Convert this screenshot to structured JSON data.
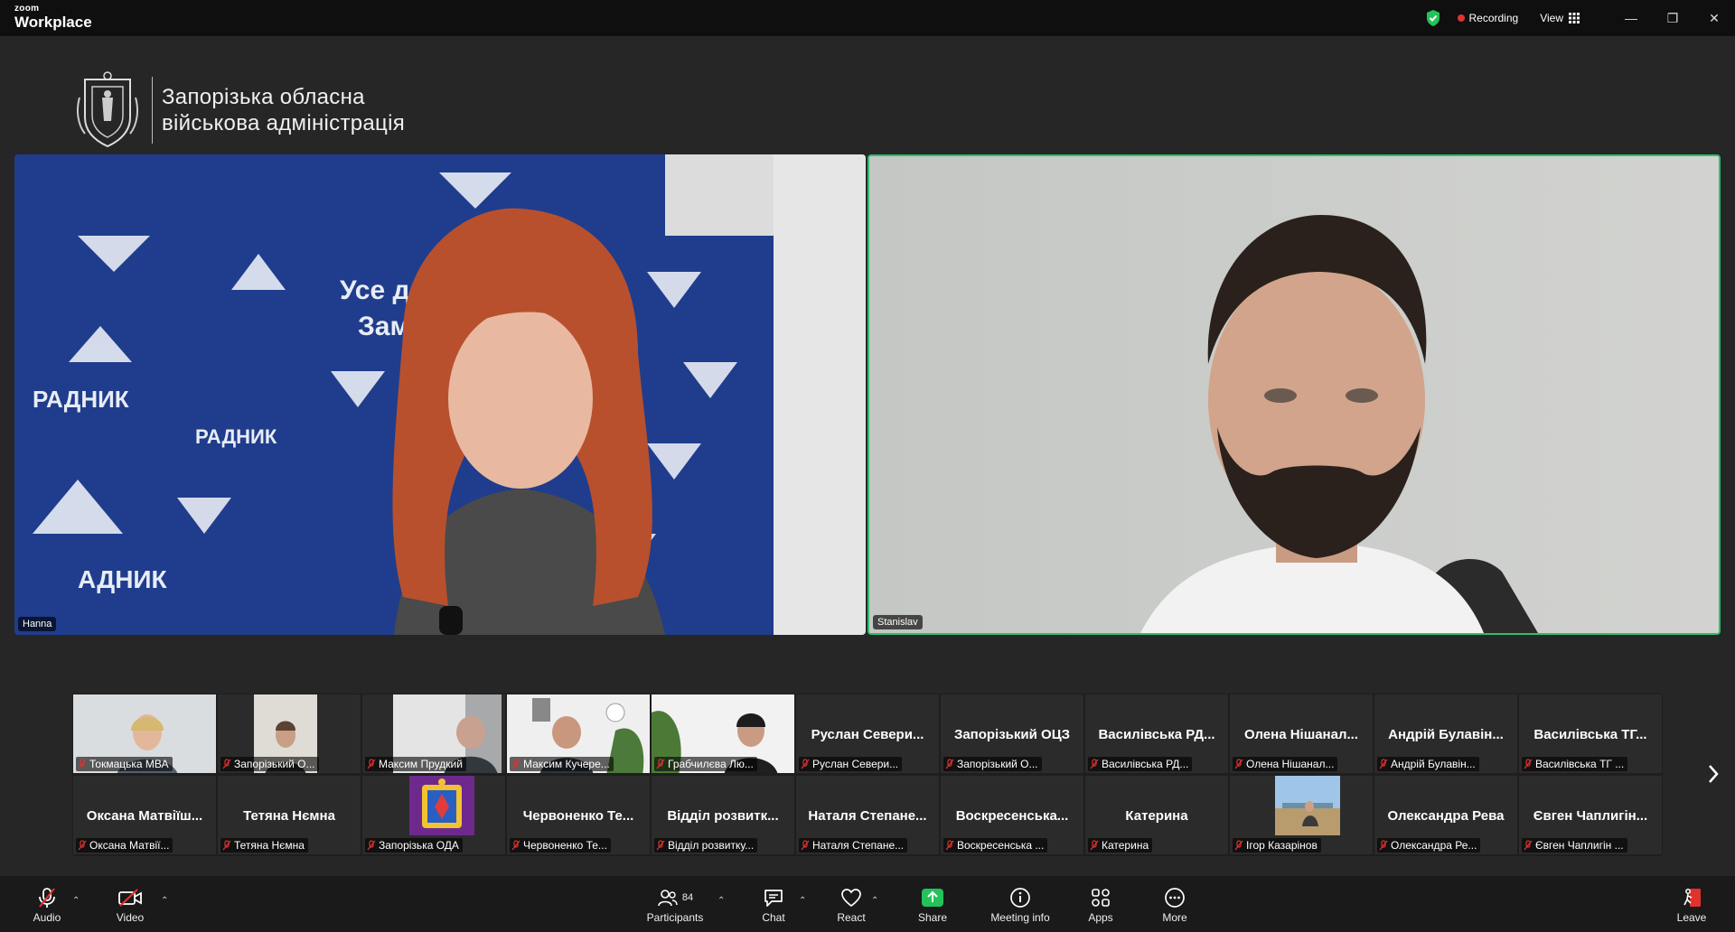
{
  "window": {
    "brand_small": "zoom",
    "brand_large": "Workplace",
    "recording_label": "Recording",
    "view_label": "View",
    "controls": [
      "—",
      "❐",
      "✕"
    ]
  },
  "header": {
    "org_line1": "Запорізька обласна",
    "org_line2": "військова адміністрація"
  },
  "videos": [
    {
      "name": "Hanna"
    },
    {
      "name": "Stanislav"
    }
  ],
  "gallery": {
    "row1": [
      {
        "display": "",
        "label": "Токмацька МВА"
      },
      {
        "display": "",
        "label": "Запорізький О..."
      },
      {
        "display": "",
        "label": "Максим Прудкий"
      },
      {
        "display": "",
        "label": "Максим Кучере..."
      },
      {
        "display": "",
        "label": "Грабчилєва Лю..."
      },
      {
        "display": "Руслан Севери...",
        "label": "Руслан Севери..."
      },
      {
        "display": "Запорізький ОЦЗ",
        "label": "Запорізький О..."
      },
      {
        "display": "Василівська РД...",
        "label": "Василівська РД..."
      },
      {
        "display": "Олена Нішанал...",
        "label": "Олена Нішанал..."
      },
      {
        "display": "Андрій Булавін...",
        "label": "Андрій Булавін..."
      },
      {
        "display": "Василівська ТГ...",
        "label": "Василівська ТГ ..."
      }
    ],
    "row2": [
      {
        "display": "Оксана Матвіїш...",
        "label": "Оксана Матвії..."
      },
      {
        "display": "Тетяна Нємна",
        "label": "Тетяна Нємна"
      },
      {
        "display": "",
        "label": "Запорізька ОДА"
      },
      {
        "display": "Червоненко Те...",
        "label": "Червоненко Те..."
      },
      {
        "display": "Відділ розвитк...",
        "label": "Відділ розвитку..."
      },
      {
        "display": "Наталя Степане...",
        "label": "Наталя Степане..."
      },
      {
        "display": "Воскресенська...",
        "label": "Воскресенська ..."
      },
      {
        "display": "Катерина",
        "label": "Катерина"
      },
      {
        "display": "",
        "label": "Ігор Казарінов"
      },
      {
        "display": "Олександра Рева",
        "label": "Олександра Ре..."
      },
      {
        "display": "Євген Чаплигін...",
        "label": "Євген Чаплигін ..."
      }
    ]
  },
  "toolbar": {
    "audio": "Audio",
    "video": "Video",
    "participants": "Participants",
    "participants_count": "84",
    "chat": "Chat",
    "react": "React",
    "share": "Share",
    "meeting_info": "Meeting info",
    "apps": "Apps",
    "more": "More",
    "leave": "Leave"
  },
  "colors": {
    "active_speaker_border": "#2fbf6c",
    "recording_dot": "#e0322f",
    "share_green": "#23c25a",
    "leave_red": "#e0322f"
  }
}
